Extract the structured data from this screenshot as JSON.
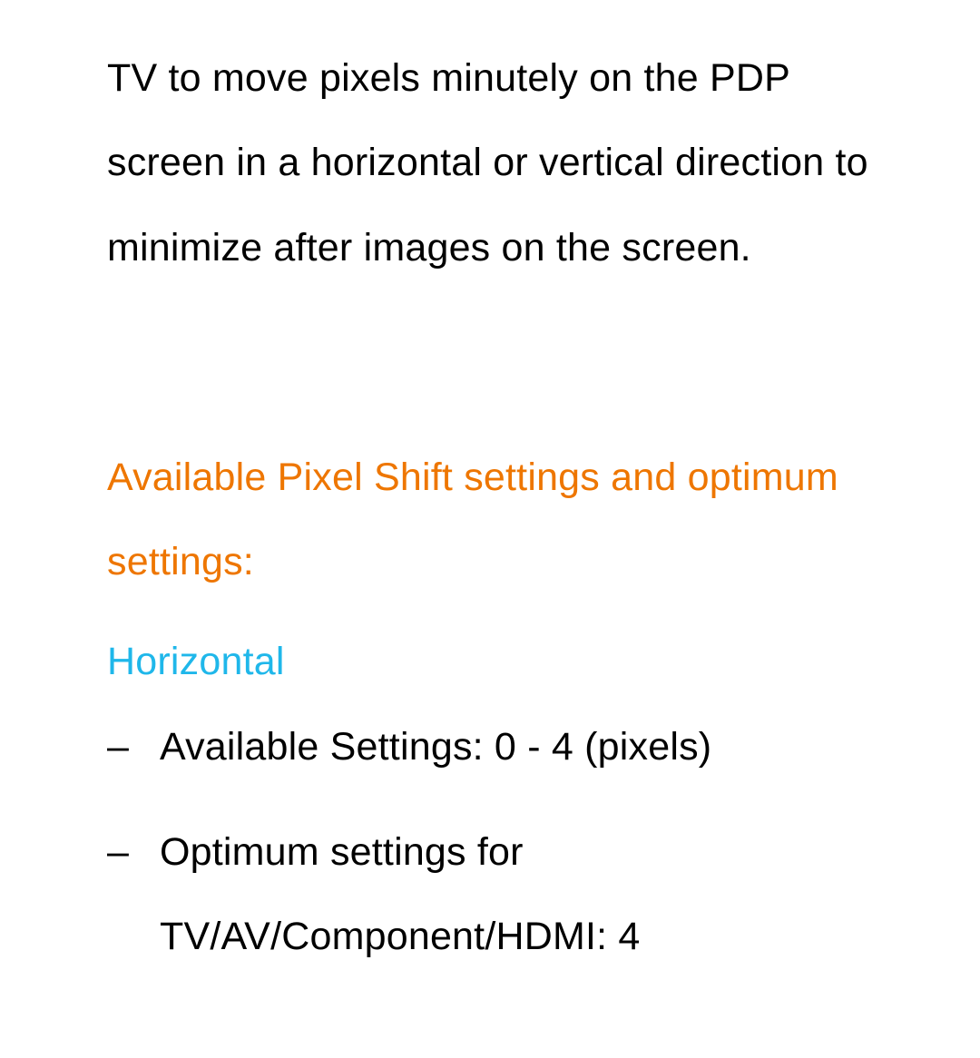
{
  "intro": "TV to move pixels minutely on the PDP screen in a horizontal or vertical direction to minimize after images on the screen.",
  "section_heading": "Available Pixel Shift settings and optimum settings:",
  "sections": [
    {
      "label": "Horizontal",
      "items": [
        "Available Settings: 0 - 4 (pixels)",
        "Optimum settings for TV/AV/Component/HDMI: 4"
      ]
    }
  ],
  "bullet_dash": "–"
}
